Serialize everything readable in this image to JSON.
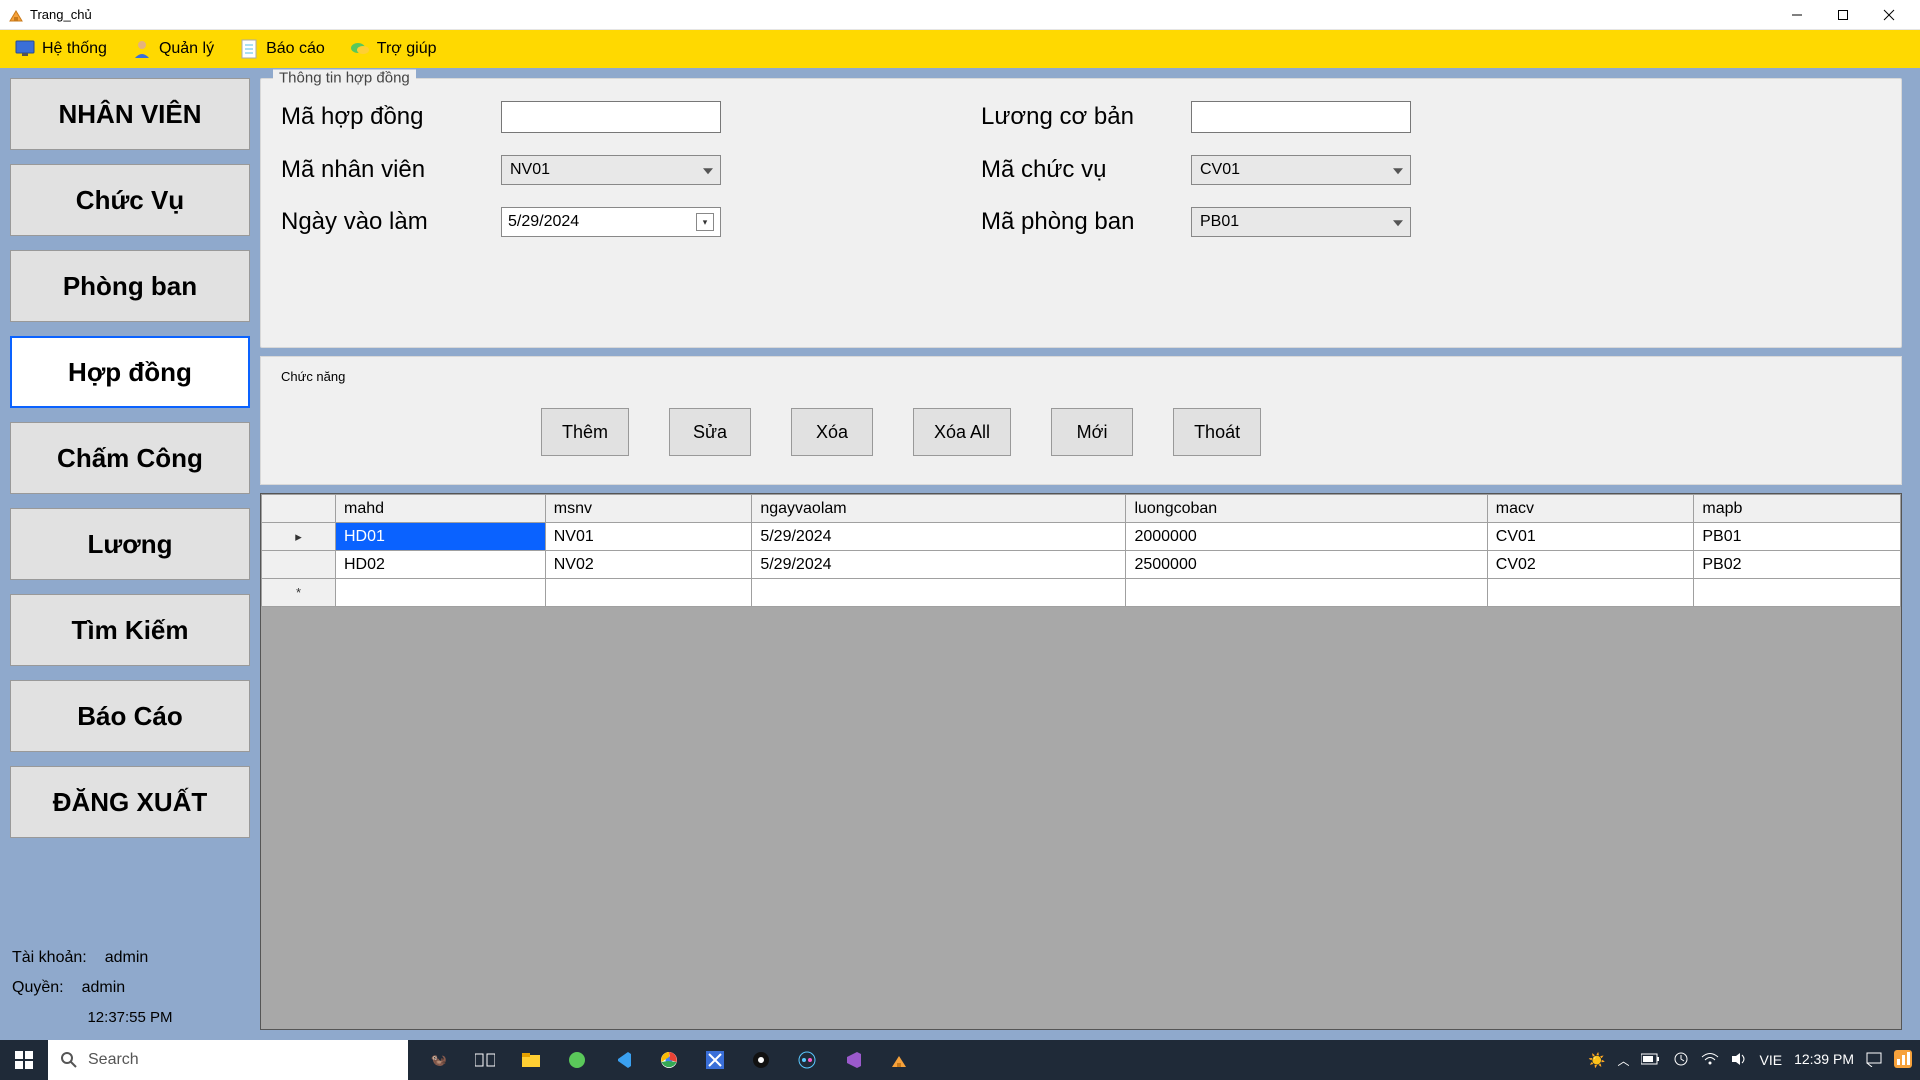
{
  "window": {
    "title": "Trang_chủ"
  },
  "menubar": [
    {
      "id": "hethong",
      "label": "Hệ thống",
      "icon": "monitor-icon"
    },
    {
      "id": "quanly",
      "label": "Quản lý",
      "icon": "person-icon"
    },
    {
      "id": "baocao",
      "label": "Báo cáo",
      "icon": "paper-icon"
    },
    {
      "id": "trogiup",
      "label": "Trợ giúp",
      "icon": "chat-icon"
    }
  ],
  "sidebar": {
    "items": [
      {
        "id": "nhanvien",
        "label": "NHÂN VIÊN"
      },
      {
        "id": "chucvu",
        "label": "Chức Vụ"
      },
      {
        "id": "phongban",
        "label": "Phòng ban"
      },
      {
        "id": "hopdong",
        "label": "Hợp đồng",
        "active": true
      },
      {
        "id": "chamcong",
        "label": "Chấm Công"
      },
      {
        "id": "luong",
        "label": "Lương"
      },
      {
        "id": "timkiem",
        "label": "Tìm Kiếm"
      },
      {
        "id": "baocao2",
        "label": "Báo Cáo"
      },
      {
        "id": "dangxuat",
        "label": "ĐĂNG XUẤT"
      }
    ],
    "status": {
      "account_label": "Tài khoản:",
      "account_value": "admin",
      "role_label": "Quyền:",
      "role_value": "admin",
      "clock": "12:37:55 PM"
    }
  },
  "form": {
    "legend": "Thông tin hợp đồng",
    "fields": {
      "mahd_label": "Mã hợp đồng",
      "mahd_value": "",
      "luong_label": "Lương cơ bản",
      "luong_value": "",
      "manv_label": "Mã nhân viên",
      "manv_value": "NV01",
      "macv_label": "Mã chức vụ",
      "macv_value": "CV01",
      "ngay_label": "Ngày vào làm",
      "ngay_value": "5/29/2024",
      "mapb_label": "Mã phòng ban",
      "mapb_value": "PB01"
    }
  },
  "functions": {
    "legend": "Chức năng",
    "buttons": [
      {
        "id": "them",
        "label": "Thêm"
      },
      {
        "id": "sua",
        "label": "Sửa"
      },
      {
        "id": "xoa",
        "label": "Xóa"
      },
      {
        "id": "xoaall",
        "label": "Xóa All"
      },
      {
        "id": "moi",
        "label": "Mới"
      },
      {
        "id": "thoat",
        "label": "Thoát"
      }
    ]
  },
  "grid": {
    "columns": [
      "mahd",
      "msnv",
      "ngayvaolam",
      "luongcoban",
      "macv",
      "mapb"
    ],
    "rows": [
      {
        "selected": true,
        "marker": "▸",
        "cells": [
          "HD01",
          "NV01",
          "5/29/2024",
          "2000000",
          "CV01",
          "PB01"
        ]
      },
      {
        "selected": false,
        "marker": "",
        "cells": [
          "HD02",
          "NV02",
          "5/29/2024",
          "2500000",
          "CV02",
          "PB02"
        ]
      },
      {
        "selected": false,
        "marker": "*",
        "cells": [
          "",
          "",
          "",
          "",
          "",
          ""
        ]
      }
    ]
  },
  "taskbar": {
    "search_placeholder": "Search",
    "lang": "VIE",
    "time": "12:39 PM"
  }
}
